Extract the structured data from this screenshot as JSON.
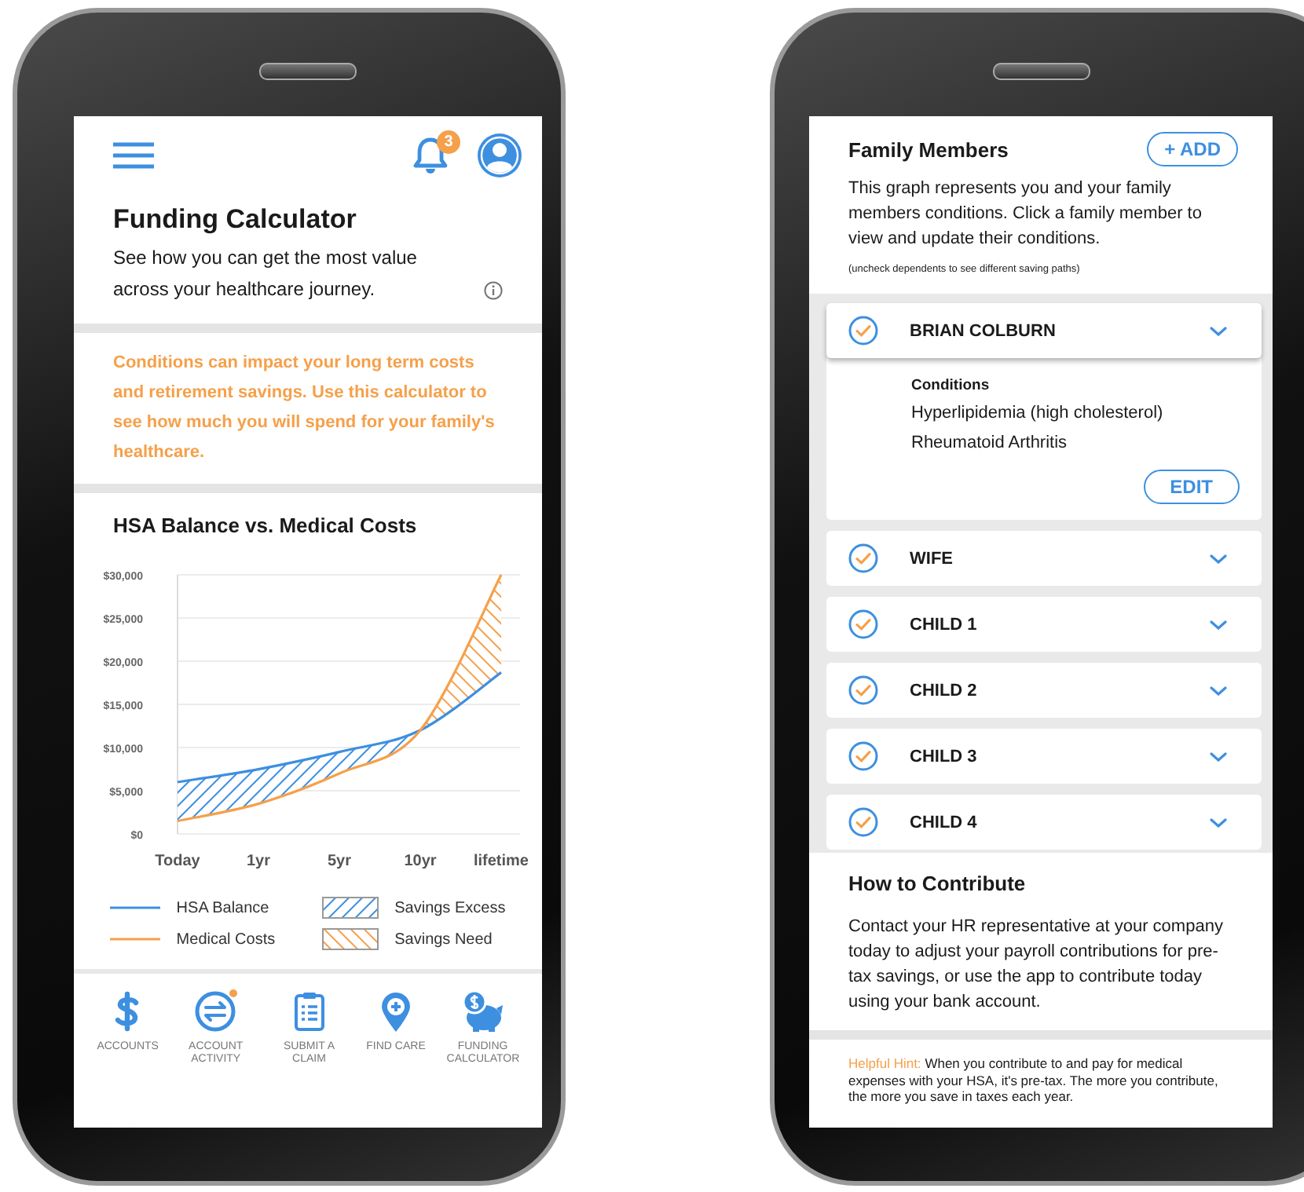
{
  "calculator_screen": {
    "notification_count": "3",
    "title": "Funding Calculator",
    "subtitle": "See how you can get the most value across your healthcare journey.",
    "notice": "Conditions can impact your long term costs and retirement savings. Use this calculator to see how much you will spend for your family's healthcare.",
    "chart": {
      "chart_data": {
        "type": "line",
        "title": "HSA Balance vs. Medical Costs",
        "categories": [
          "Today",
          "1yr",
          "5yr",
          "10yr",
          "lifetime"
        ],
        "series": [
          {
            "name": "HSA Balance",
            "color": "#3d8fe0",
            "values": [
              6000,
              7500,
              9500,
              12000,
              18700
            ]
          },
          {
            "name": "Medical Costs",
            "color": "#f5a04a",
            "values": [
              1500,
              3500,
              7000,
              12000,
              30000
            ]
          }
        ],
        "ylim": [
          0,
          30000
        ],
        "grid": true,
        "yticks": [
          {
            "value": 0,
            "label": "$0"
          },
          {
            "value": 5000,
            "label": "$5,000"
          },
          {
            "value": 10000,
            "label": "$10,000"
          },
          {
            "value": 15000,
            "label": "$15,000"
          },
          {
            "value": 20000,
            "label": "$20,000"
          },
          {
            "value": 25000,
            "label": "$25,000"
          },
          {
            "value": 30000,
            "label": "$30,000"
          }
        ]
      },
      "hatch_legend": [
        {
          "label": "Savings Excess",
          "color": "#3d8fe0"
        },
        {
          "label": "Savings Need",
          "color": "#f5a04a"
        }
      ]
    },
    "tab_bar": [
      {
        "label": "ACCOUNTS",
        "kind": "dollar",
        "alert": false
      },
      {
        "label": "ACCOUNT ACTIVITY",
        "kind": "exchange",
        "alert": true
      },
      {
        "label": "SUBMIT A CLAIM",
        "kind": "clipboard",
        "alert": false
      },
      {
        "label": "FIND CARE",
        "kind": "pin",
        "alert": false
      },
      {
        "label": "FUNDING CALCULATOR",
        "kind": "piggy",
        "alert": false
      }
    ]
  },
  "family_screen": {
    "title": "Family Members",
    "add_button": "+ ADD",
    "description": "This graph represents you and your family members conditions. Click a family member to view and update their conditions.",
    "note": "(uncheck dependents to see different saving paths)",
    "members": [
      {
        "name": "BRIAN COLBURN",
        "checked": true,
        "expanded": true,
        "conditions_label": "Conditions",
        "conditions": [
          "Hyperlipidemia (high cholesterol)",
          "Rheumatoid Arthritis"
        ],
        "edit_button": "EDIT"
      },
      {
        "name": "WIFE",
        "checked": true,
        "expanded": false
      },
      {
        "name": "CHILD 1",
        "checked": true,
        "expanded": false
      },
      {
        "name": "CHILD 2",
        "checked": true,
        "expanded": false
      },
      {
        "name": "CHILD 3",
        "checked": true,
        "expanded": false
      },
      {
        "name": "CHILD 4",
        "checked": true,
        "expanded": false
      }
    ],
    "contribute": {
      "title": "How to Contribute",
      "text": "Contact your HR representative at your company today to adjust your payroll contributions for pre-tax savings, or use the app to contribute today using your bank account."
    },
    "hint_label": "Helpful Hint:",
    "hint_text": "When you contribute to and pay for medical expenses with your HSA, it's pre-tax. The more you contribute, the more you save in taxes each year."
  }
}
